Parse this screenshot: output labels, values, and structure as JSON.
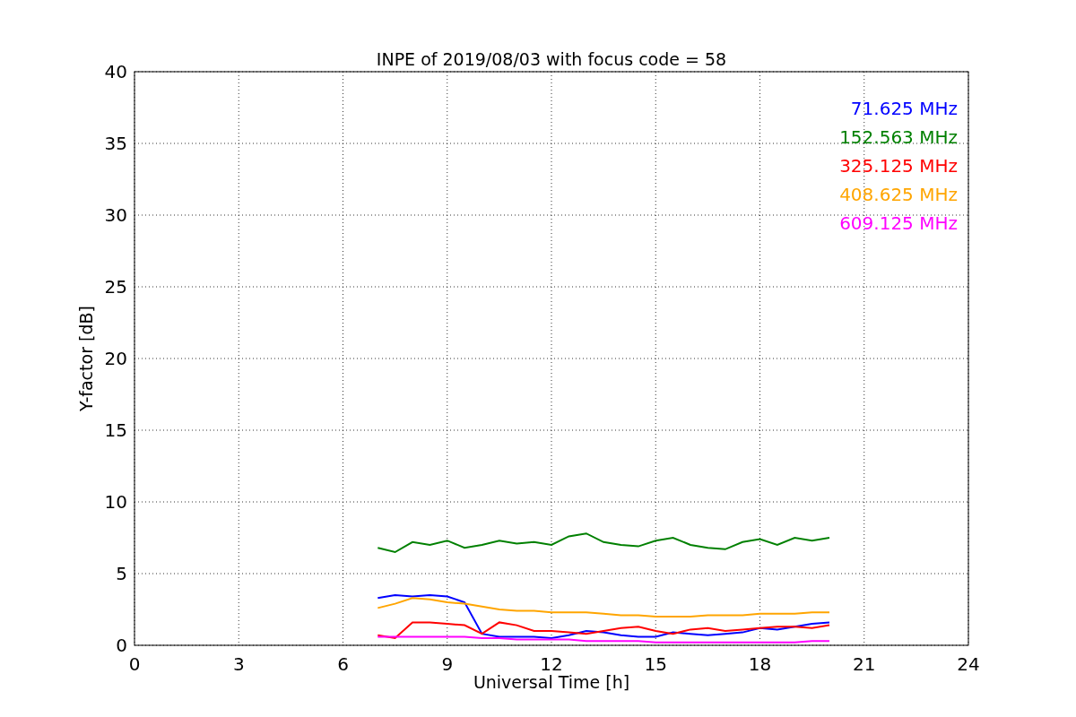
{
  "chart_data": {
    "type": "line",
    "title": "INPE of 2019/08/03 with focus code = 58",
    "xlabel": "Universal Time [h]",
    "ylabel": "Y-factor [dB]",
    "x": [
      7,
      7.5,
      8,
      8.5,
      9,
      9.5,
      10,
      10.5,
      11,
      11.5,
      12,
      12.5,
      13,
      13.5,
      14,
      14.5,
      15,
      15.5,
      16,
      16.5,
      17,
      17.5,
      18,
      18.5,
      19,
      19.5,
      20
    ],
    "series": [
      {
        "name": "71.625 MHz",
        "color": "#0000ff",
        "values": [
          3.3,
          3.5,
          3.4,
          3.5,
          3.4,
          3.0,
          0.8,
          0.6,
          0.6,
          0.6,
          0.5,
          0.7,
          1.0,
          0.9,
          0.7,
          0.6,
          0.6,
          0.9,
          0.8,
          0.7,
          0.8,
          0.9,
          1.2,
          1.1,
          1.3,
          1.5,
          1.6
        ]
      },
      {
        "name": "152.563 MHz",
        "color": "#008000",
        "values": [
          6.8,
          6.5,
          7.2,
          7.0,
          7.3,
          6.8,
          7.0,
          7.3,
          7.1,
          7.2,
          7.0,
          7.6,
          7.8,
          7.2,
          7.0,
          6.9,
          7.3,
          7.5,
          7.0,
          6.8,
          6.7,
          7.2,
          7.4,
          7.0,
          7.5,
          7.3,
          7.5
        ]
      },
      {
        "name": "325.125 MHz",
        "color": "#ff0000",
        "values": [
          0.7,
          0.5,
          1.6,
          1.6,
          1.5,
          1.4,
          0.8,
          1.6,
          1.4,
          1.0,
          1.0,
          0.9,
          0.8,
          1.0,
          1.2,
          1.3,
          1.0,
          0.8,
          1.1,
          1.2,
          1.0,
          1.1,
          1.2,
          1.3,
          1.3,
          1.2,
          1.4
        ]
      },
      {
        "name": "408.625 MHz",
        "color": "#ffa500",
        "values": [
          2.6,
          2.9,
          3.3,
          3.2,
          3.0,
          2.9,
          2.7,
          2.5,
          2.4,
          2.4,
          2.3,
          2.3,
          2.3,
          2.2,
          2.1,
          2.1,
          2.0,
          2.0,
          2.0,
          2.1,
          2.1,
          2.1,
          2.2,
          2.2,
          2.2,
          2.3,
          2.3
        ]
      },
      {
        "name": "609.125 MHz",
        "color": "#ff00ff",
        "values": [
          0.6,
          0.6,
          0.6,
          0.6,
          0.6,
          0.6,
          0.5,
          0.5,
          0.4,
          0.4,
          0.4,
          0.4,
          0.3,
          0.3,
          0.3,
          0.3,
          0.2,
          0.2,
          0.2,
          0.2,
          0.2,
          0.2,
          0.2,
          0.2,
          0.2,
          0.3,
          0.3
        ]
      }
    ],
    "grid": true,
    "xlim": [
      0,
      24
    ],
    "ylim": [
      0,
      40
    ],
    "xticks": [
      0,
      3,
      6,
      9,
      12,
      15,
      18,
      21,
      24
    ],
    "yticks": [
      0,
      5,
      10,
      15,
      20,
      25,
      30,
      35,
      40
    ]
  }
}
